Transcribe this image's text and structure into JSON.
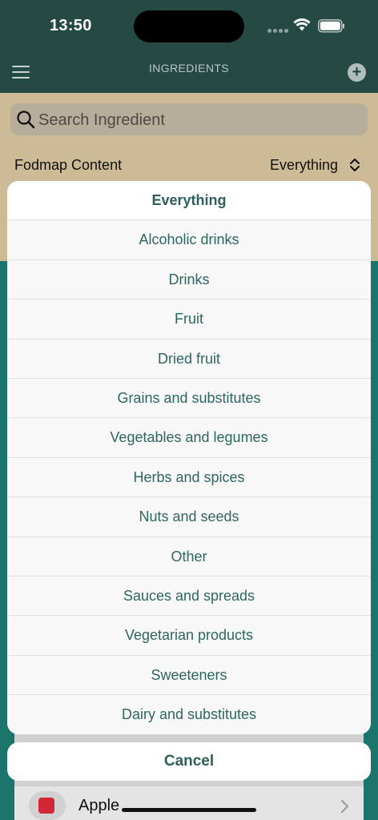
{
  "status_bar": {
    "time": "13:50"
  },
  "nav": {
    "title": "INGREDIENTS"
  },
  "search": {
    "placeholder": "Search Ingredient"
  },
  "filter": {
    "label": "Fodmap Content",
    "value": "Everything"
  },
  "list": {
    "rows": [
      {
        "label": "Apple",
        "swatch_color": "#d32738"
      }
    ]
  },
  "action_sheet": {
    "selected": "Everything",
    "options": [
      "Everything",
      "Alcoholic drinks",
      "Drinks",
      "Fruit",
      "Dried fruit",
      "Grains and substitutes",
      "Vegetables and legumes",
      "Herbs and spices",
      "Nuts and seeds",
      "Other",
      "Sauces and spreads",
      "Vegetarian products",
      "Sweeteners",
      "Dairy and substitutes"
    ],
    "cancel_label": "Cancel"
  },
  "colors": {
    "header": "#254943",
    "accent_text": "#2e6660",
    "beige": "#cdbb97",
    "teal": "#1b756c"
  }
}
